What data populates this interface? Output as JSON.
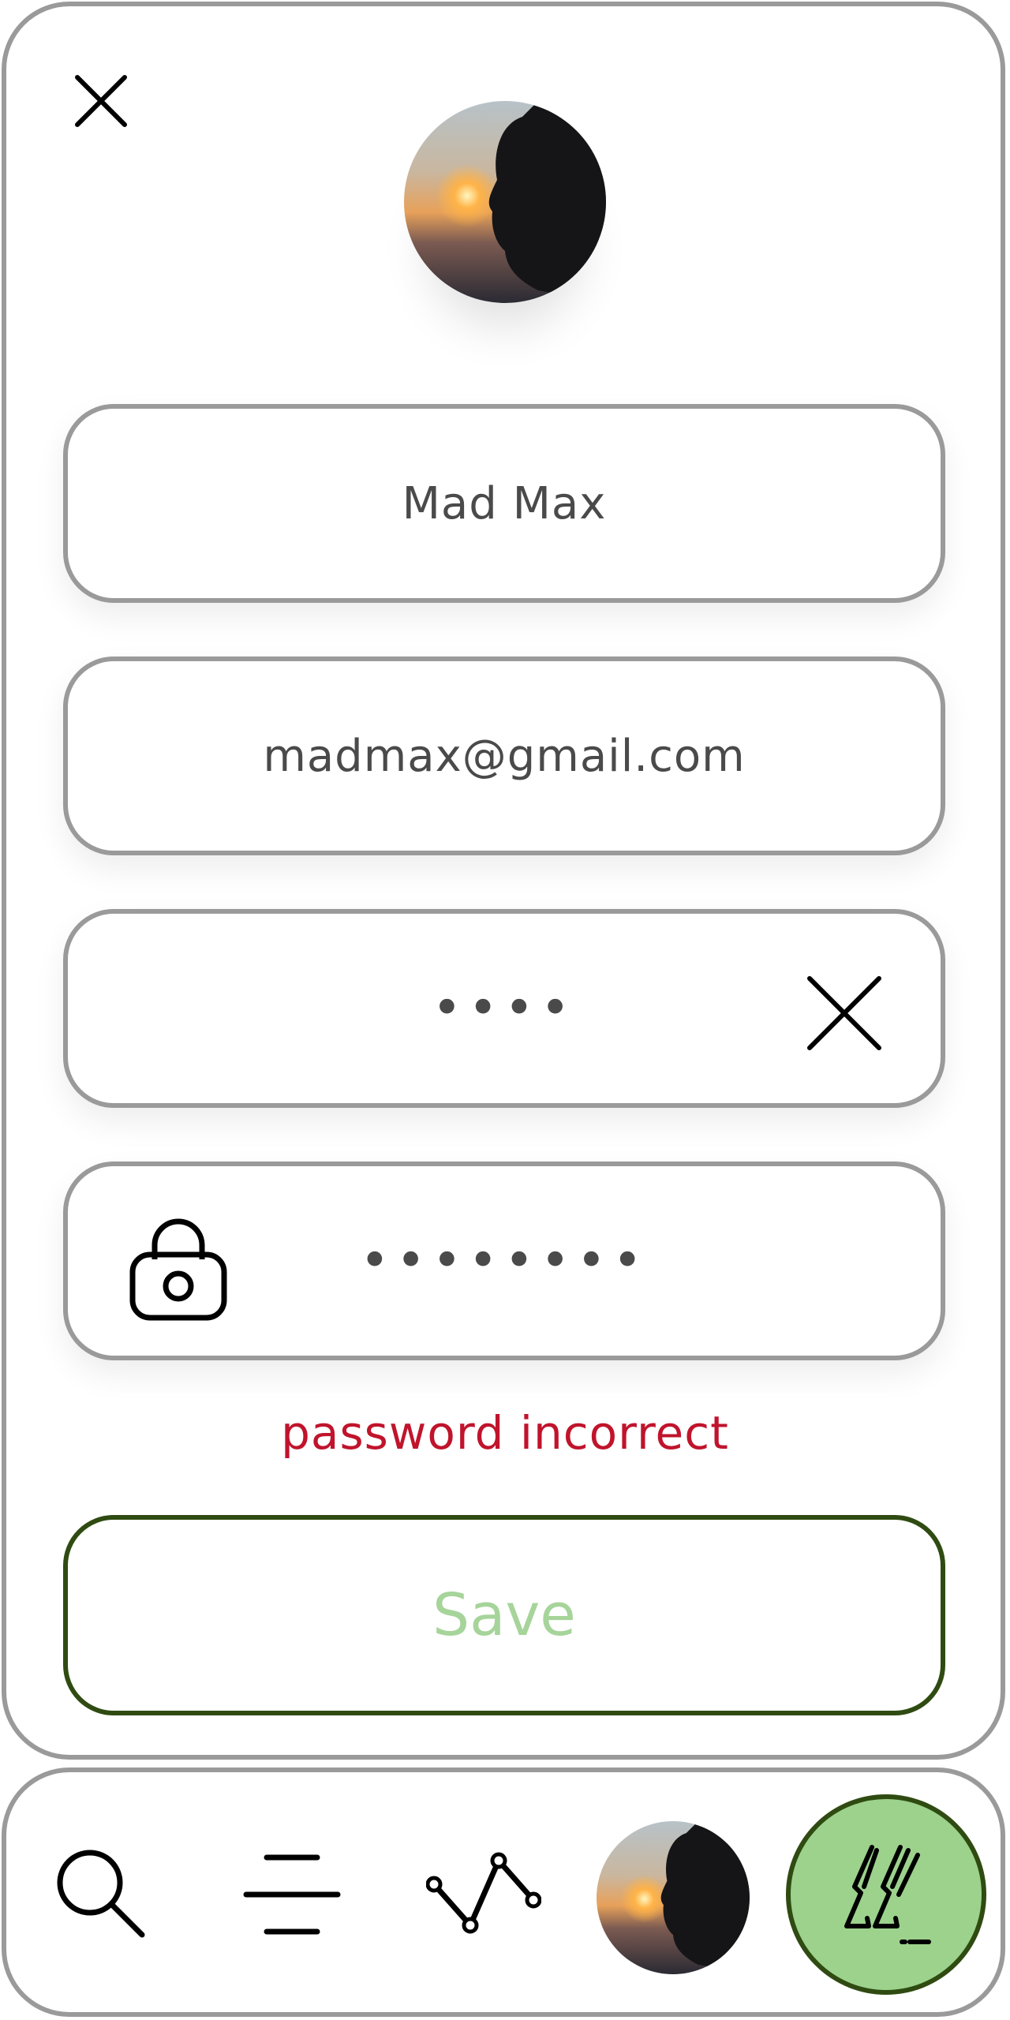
{
  "profile": {
    "name_value": "Mad Max",
    "email_value": "madmax@gmail.com",
    "password_current_value": "1234",
    "password_new_value": "12345678"
  },
  "error": {
    "message": "password incorrect",
    "color": "#c0142c"
  },
  "save": {
    "label": "Save",
    "border_color": "#2f4b12",
    "text_color": "#a6d49a"
  },
  "icons": {
    "close": "close-icon",
    "clear": "clear-icon",
    "lock": "lock-icon",
    "search": "search-icon",
    "menu": "menu-icon",
    "graph": "graph-icon",
    "action": "action-icon"
  },
  "colors": {
    "accent_green": "#9cd28c",
    "border_gray": "#9a9a9a"
  }
}
